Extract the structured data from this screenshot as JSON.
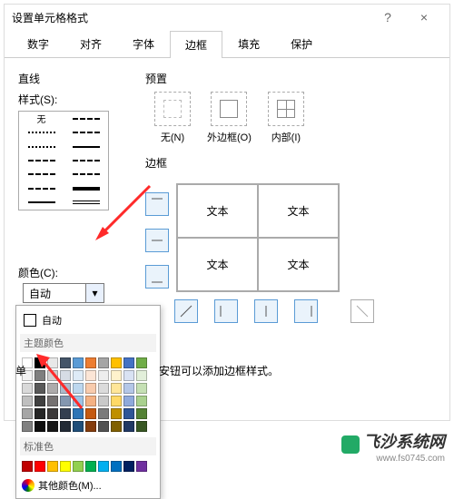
{
  "dialog": {
    "title": "设置单元格格式",
    "help": "?",
    "close": "×"
  },
  "tabs": [
    "数字",
    "对齐",
    "字体",
    "边框",
    "填充",
    "保护"
  ],
  "active_tab": 3,
  "line": {
    "section": "直线",
    "style_label": "样式(S):",
    "none": "无",
    "color_label": "颜色(C):",
    "color_value": "自动"
  },
  "preset": {
    "section": "预置",
    "items": [
      {
        "label": "无(N)"
      },
      {
        "label": "外边框(O)"
      },
      {
        "label": "内部(I)"
      }
    ]
  },
  "border": {
    "section": "边框"
  },
  "preview_cells": [
    "文本",
    "文本",
    "文本",
    "文本"
  ],
  "hint_text": "安钮可以添加边框样式。",
  "edge_label": "单",
  "popup": {
    "auto": "自动",
    "theme": "主题颜色",
    "standard": "标准色",
    "more": "其他颜色(M)...",
    "theme_colors": [
      "#ffffff",
      "#000000",
      "#e8e8e8",
      "#445569",
      "#5b9bd5",
      "#ed7d31",
      "#a5a5a5",
      "#ffc000",
      "#4472c4",
      "#70ad47",
      "#f2f2f2",
      "#7f7f7f",
      "#d0cece",
      "#d6dce5",
      "#deebf7",
      "#fbe5d6",
      "#ededed",
      "#fff2cc",
      "#d9e2f3",
      "#e2efda",
      "#d9d9d9",
      "#595959",
      "#aeabab",
      "#adb9ca",
      "#bdd7ee",
      "#f8cbad",
      "#dbdbdb",
      "#ffe699",
      "#b4c7e7",
      "#c5e0b4",
      "#bfbfbf",
      "#404040",
      "#757171",
      "#8497b0",
      "#9dc3e6",
      "#f4b183",
      "#c9c9c9",
      "#ffd966",
      "#8faadc",
      "#a9d18e",
      "#a6a6a6",
      "#262626",
      "#3b3838",
      "#333f50",
      "#2e75b6",
      "#c55a11",
      "#7b7b7b",
      "#bf9000",
      "#2f5597",
      "#548235",
      "#808080",
      "#0d0d0d",
      "#171717",
      "#222a35",
      "#1f4e79",
      "#843c0c",
      "#525252",
      "#806000",
      "#203864",
      "#385723"
    ],
    "standard_colors": [
      "#c00000",
      "#ff0000",
      "#ffc000",
      "#ffff00",
      "#92d050",
      "#00b050",
      "#00b0f0",
      "#0070c0",
      "#002060",
      "#7030a0"
    ]
  },
  "watermark": {
    "text": "飞沙系统网",
    "url": "www.fs0745.com"
  }
}
